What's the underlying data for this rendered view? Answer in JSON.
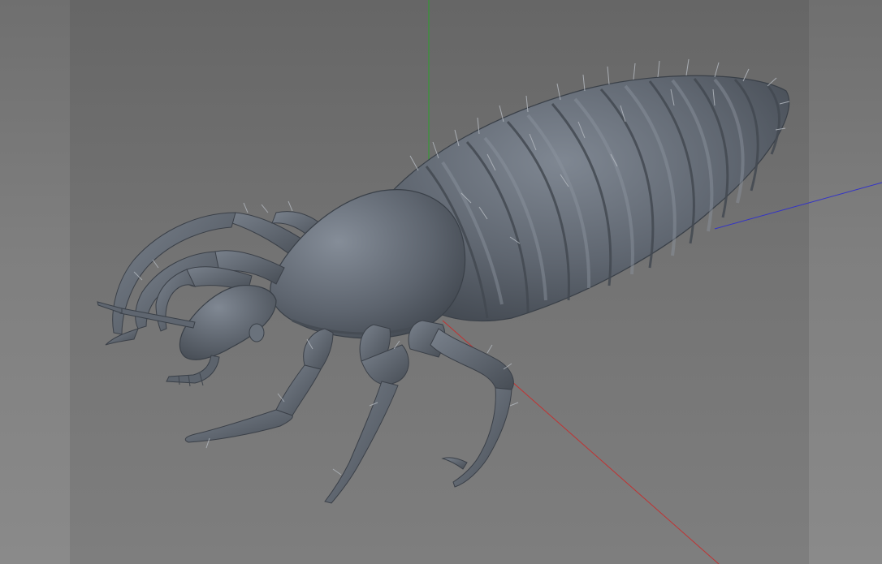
{
  "viewport": {
    "colors": {
      "background_outer": "#8a8a8a",
      "background_render": "#6f6f6f",
      "model_base": "#5f6670",
      "model_shadow": "#3b4048",
      "model_highlight": "#8d95a0",
      "axis_x": "#c03333",
      "axis_y": "#2aa02a",
      "axis_z": "#3333c8"
    },
    "axes": [
      {
        "name": "x",
        "color": "#c03333"
      },
      {
        "name": "y",
        "color": "#2aa02a"
      },
      {
        "name": "z",
        "color": "#3333c8"
      }
    ],
    "model": {
      "subject": "louse",
      "abdomen_segments": 9,
      "legs": 6
    }
  }
}
